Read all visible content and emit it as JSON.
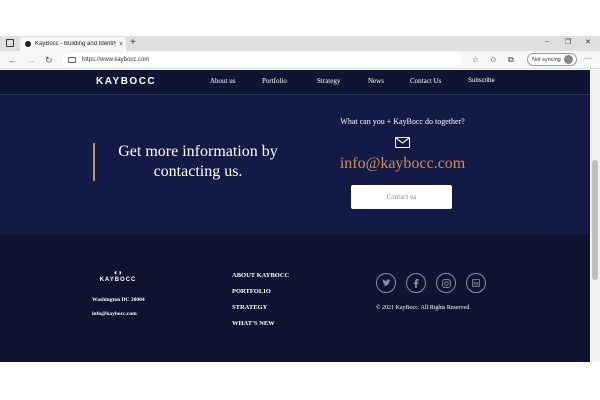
{
  "browser": {
    "tab_title": "KayBocc - Building and Identifyi",
    "tab_close": "×",
    "new_tab": "+",
    "url": "https://www.kaybocc.com",
    "sync_label": "Not syncing",
    "win_min": "–",
    "win_max": "❐",
    "win_close": "✕",
    "back": "←",
    "forward": "→",
    "refresh": "↻",
    "menu": "···"
  },
  "nav": {
    "logo": "KAYBOCC",
    "links": [
      "About us",
      "Portfolio",
      "Strategy",
      "News",
      "Contact Us"
    ],
    "subscribe": "Subscribe"
  },
  "cta": {
    "heading": "Get more information by contacting us.",
    "question": "What can you + KayBocc do together?",
    "email": "info@kaybocc.com",
    "button": "Contact us"
  },
  "footer": {
    "logo_word": "KAYBOCC",
    "address": "Washington DC 20004",
    "email": "info@kaybocc.com",
    "links": [
      "ABOUT KAYBOCC",
      "PORTFOLIO",
      "STRATEGY",
      "WHAT'S NEW"
    ],
    "social": [
      "twitter-icon",
      "facebook-icon",
      "instagram-icon",
      "linkedin-icon"
    ],
    "copyright": "© 2021 KayBocc. All Rights Reserved."
  },
  "colors": {
    "nav_bg": "#0f1633",
    "cta_bg": "#131a45",
    "footer_bg": "#0e1430",
    "accent": "#c98f63"
  }
}
